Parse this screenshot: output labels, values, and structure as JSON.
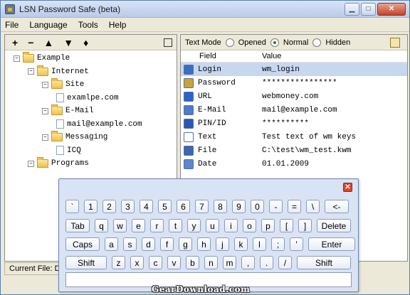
{
  "window": {
    "title": "LSN Password Safe (beta)"
  },
  "menu": [
    "File",
    "Language",
    "Tools",
    "Help"
  ],
  "left_toolbar": [
    "+",
    "−",
    "▲",
    "▼",
    "♦"
  ],
  "tree": [
    {
      "label": "Example",
      "kind": "folder",
      "depth": 0
    },
    {
      "label": "Internet",
      "kind": "folder",
      "depth": 1
    },
    {
      "label": "Site",
      "kind": "folder",
      "depth": 2
    },
    {
      "label": "examlpe.com",
      "kind": "doc",
      "depth": 3
    },
    {
      "label": "E-Mail",
      "kind": "folder",
      "depth": 2
    },
    {
      "label": "mail@example.com",
      "kind": "doc",
      "depth": 3
    },
    {
      "label": "Messaging",
      "kind": "folder",
      "depth": 2
    },
    {
      "label": "ICQ",
      "kind": "doc",
      "depth": 3
    },
    {
      "label": "Programs",
      "kind": "folder",
      "depth": 1
    }
  ],
  "text_mode": {
    "label": "Text Mode",
    "options": [
      "Opened",
      "Normal",
      "Hidden"
    ],
    "selected": "Normal"
  },
  "table": {
    "headers": [
      "Field",
      "Value"
    ],
    "rows": [
      {
        "field": "Login",
        "value": "wm_login",
        "icon": "user-icon",
        "color": "#3a6fc9"
      },
      {
        "field": "Password",
        "value": "****************",
        "icon": "key-icon",
        "color": "#c8a33a"
      },
      {
        "field": "URL",
        "value": "webmoney.com",
        "icon": "globe-icon",
        "color": "#2f62c6"
      },
      {
        "field": "E-Mail",
        "value": "mail@example.com",
        "icon": "envelope-icon",
        "color": "#4c7bc9"
      },
      {
        "field": "PIN/ID",
        "value": "**********",
        "icon": "pin-icon",
        "color": "#2a58b8"
      },
      {
        "field": "Text",
        "value": "Test text of wm keys",
        "icon": "document-icon",
        "color": "#ffffff"
      },
      {
        "field": "File",
        "value": "C:\\test\\wm_test.kwm",
        "icon": "disk-icon",
        "color": "#3c65b2"
      },
      {
        "field": "Date",
        "value": "01.01.2009",
        "icon": "calendar-icon",
        "color": "#5d86cf"
      }
    ]
  },
  "status": "Current File: D",
  "keyboard": {
    "rows": [
      [
        "`",
        "1",
        "2",
        "3",
        "4",
        "5",
        "6",
        "7",
        "8",
        "9",
        "0",
        "-",
        "=",
        "\\",
        "<-"
      ],
      [
        "Tab",
        "q",
        "w",
        "e",
        "r",
        "t",
        "y",
        "u",
        "i",
        "o",
        "p",
        "[",
        "]",
        "Delete"
      ],
      [
        "Caps",
        "a",
        "s",
        "d",
        "f",
        "g",
        "h",
        "j",
        "k",
        "l",
        ";",
        "'",
        "Enter"
      ],
      [
        "Shift",
        "z",
        "x",
        "c",
        "v",
        "b",
        "n",
        "m",
        ",",
        ".",
        "/",
        "Shift"
      ]
    ]
  },
  "watermark": "GearDownload.com"
}
